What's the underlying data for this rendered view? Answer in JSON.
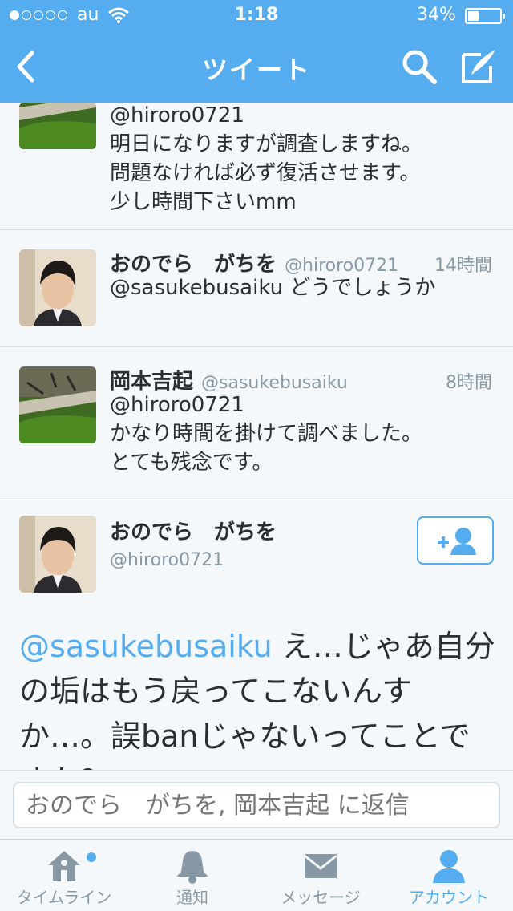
{
  "status_bar": {
    "carrier": "au",
    "time": "1:18",
    "battery": "34%",
    "battery_level": 0.34
  },
  "nav": {
    "title": "ツイート"
  },
  "tweets": [
    {
      "lines": [
        "@hiroro0721",
        "明日になりますが調査しますね。",
        "問題なければ必ず復活させます。",
        "少し時間下さいmm"
      ]
    },
    {
      "name": "おのでら　がちを",
      "handle": "@hiroro0721",
      "time": "14時間",
      "lines": [
        "@sasukebusaiku どうでしょうか"
      ]
    },
    {
      "name": "岡本吉起",
      "handle": "@sasukebusaiku",
      "time": "8時間",
      "lines": [
        "@hiroro0721",
        "かなり時間を掛けて調べました。",
        "とても残念です。"
      ]
    }
  ],
  "main_tweet": {
    "name": "おのでら　がちを",
    "handle": "@hiroro0721",
    "mention": "@sasukebusaiku",
    "text": " え…じゃあ自分の垢はもう戻ってこないんすか…。誤banじゃないってことですか？"
  },
  "reply": {
    "placeholder": "おのでら　がちを, 岡本吉起 に返信"
  },
  "tabs": [
    {
      "label": "タイムライン",
      "icon": "home-icon",
      "active": false,
      "badge": true
    },
    {
      "label": "通知",
      "icon": "bell-icon",
      "active": false
    },
    {
      "label": "メッセージ",
      "icon": "envelope-icon",
      "active": false
    },
    {
      "label": "アカウント",
      "icon": "person-icon",
      "active": true
    }
  ],
  "colors": {
    "accent": "#55acee",
    "text": "#292f33",
    "muted": "#8899a6"
  }
}
